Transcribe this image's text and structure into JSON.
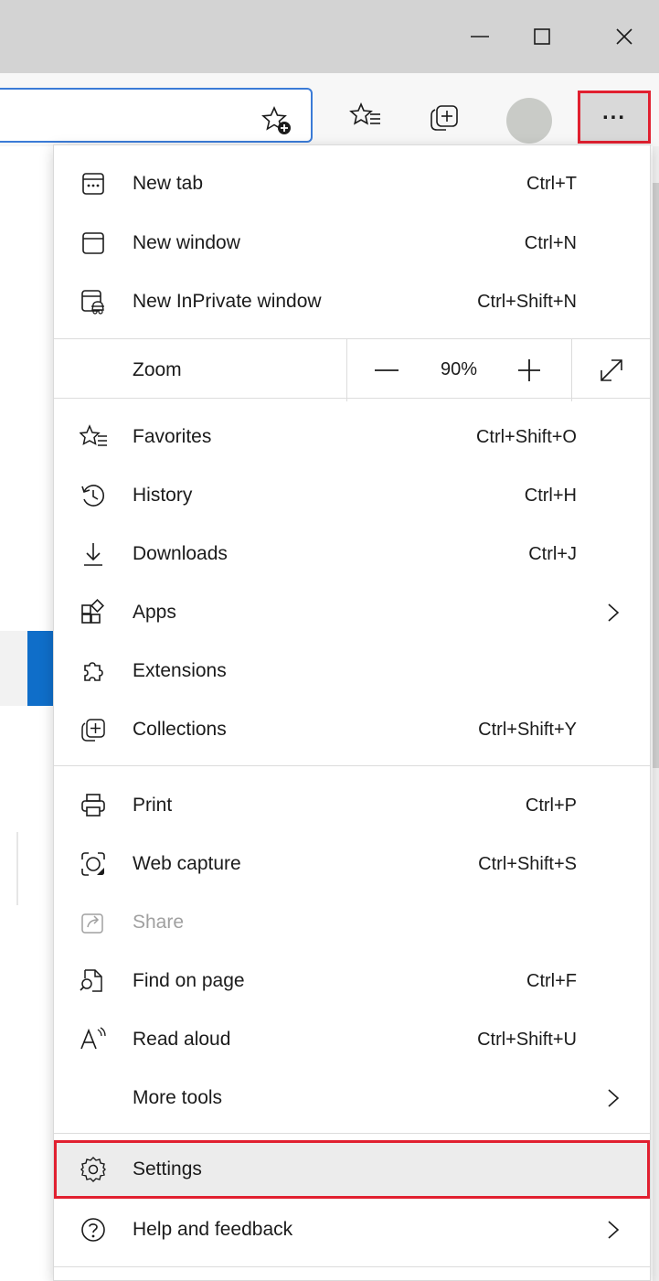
{
  "colors": {
    "highlight_border": "#e12030",
    "accent_blue": "#0f6ec9",
    "profile": "#c9cbc7"
  },
  "window": {
    "buttons": [
      {
        "name": "minimize",
        "icon": "minimize-icon"
      },
      {
        "name": "maximize",
        "icon": "maximize-icon"
      },
      {
        "name": "close",
        "icon": "close-icon"
      }
    ]
  },
  "toolbar": {
    "address_icon": "add-favorite-icon",
    "favorites_icon": "favorites-icon",
    "collections_icon": "collections-icon",
    "more_label": "..."
  },
  "menu": {
    "group1": [
      {
        "label": "New tab",
        "shortcut": "Ctrl+T",
        "icon": "new-tab-icon"
      },
      {
        "label": "New window",
        "shortcut": "Ctrl+N",
        "icon": "new-window-icon"
      },
      {
        "label": "New InPrivate window",
        "shortcut": "Ctrl+Shift+N",
        "icon": "inprivate-icon"
      }
    ],
    "zoom": {
      "label": "Zoom",
      "value": "90%"
    },
    "group2": [
      {
        "label": "Favorites",
        "shortcut": "Ctrl+Shift+O",
        "icon": "favorites-icon"
      },
      {
        "label": "History",
        "shortcut": "Ctrl+H",
        "icon": "history-icon"
      },
      {
        "label": "Downloads",
        "shortcut": "Ctrl+J",
        "icon": "download-icon"
      },
      {
        "label": "Apps",
        "shortcut": "",
        "icon": "apps-icon"
      },
      {
        "label": "Extensions",
        "shortcut": "",
        "icon": "extensions-icon"
      },
      {
        "label": "Collections",
        "shortcut": "Ctrl+Shift+Y",
        "icon": "collections-icon"
      }
    ],
    "group3": [
      {
        "label": "Print",
        "shortcut": "Ctrl+P",
        "icon": "print-icon"
      },
      {
        "label": "Web capture",
        "shortcut": "Ctrl+Shift+S",
        "icon": "web-capture-icon"
      },
      {
        "label": "Share",
        "shortcut": "",
        "icon": "share-icon"
      },
      {
        "label": "Find on page",
        "shortcut": "Ctrl+F",
        "icon": "find-icon"
      },
      {
        "label": "Read aloud",
        "shortcut": "Ctrl+Shift+U",
        "icon": "read-aloud-icon"
      },
      {
        "label": "More tools",
        "shortcut": "",
        "icon": ""
      }
    ],
    "group4": [
      {
        "label": "Settings",
        "shortcut": "",
        "icon": "settings-icon"
      },
      {
        "label": "Help and feedback",
        "shortcut": "",
        "icon": "help-icon"
      }
    ]
  }
}
